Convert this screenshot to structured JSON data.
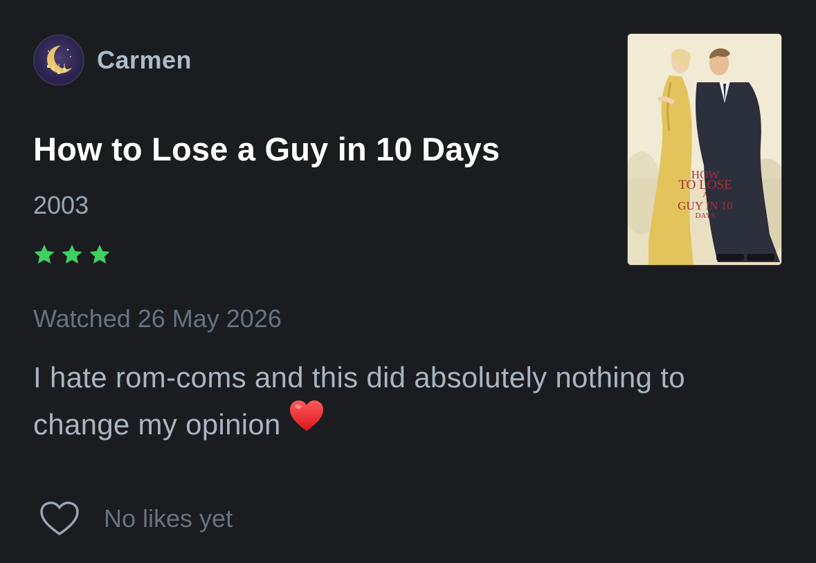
{
  "author": {
    "name": "Carmen",
    "avatar_icon": "moon-avatar-icon"
  },
  "film": {
    "title": "How to Lose a Guy in 10 Days",
    "year": "2003",
    "rating_stars": 3,
    "rating_color": "#40d060"
  },
  "review": {
    "watched": "Watched 26 May 2026",
    "text": "I hate rom-coms and this did absolutely nothing to change my opinion",
    "emoji": "red-heart-emoji"
  },
  "likes": {
    "text": "No likes yet",
    "icon": "heart-outline-icon"
  },
  "poster": {
    "line1": "HOW",
    "line2": "TO LOSE",
    "line3": "A",
    "line4": "GUY IN 10",
    "line5": "DAYS",
    "title_color": "#a3303a"
  }
}
